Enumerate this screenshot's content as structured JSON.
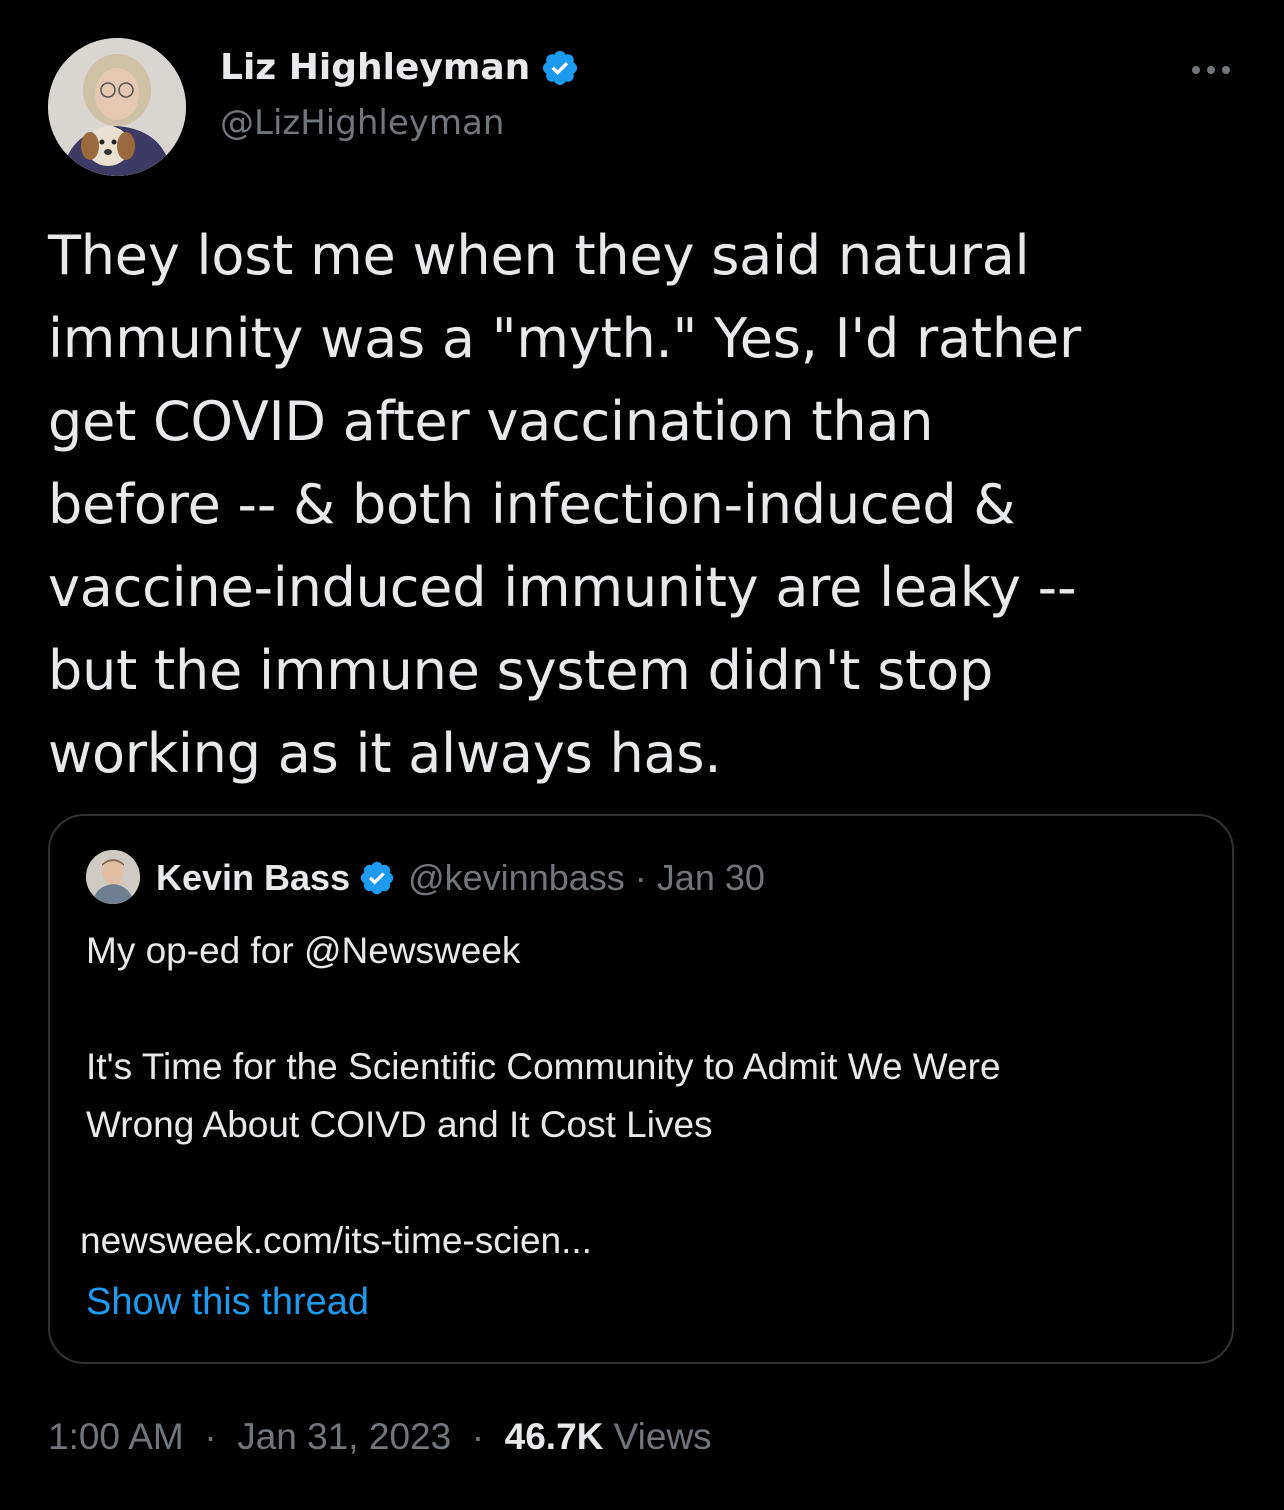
{
  "author": {
    "name": "Liz Highleyman",
    "handle": "@LizHighleyman",
    "verified": true,
    "avatar_icon": "profile-photo-with-dog"
  },
  "more_icon": "more-dots-icon",
  "tweet": {
    "text_lines": [
      "They lost me when they said natural",
      "immunity was a \"myth.\" Yes, I'd rather",
      "get COVID after vaccination than",
      "before -- & both infection-induced &",
      "vaccine-induced immunity are leaky --",
      "but the immune system didn't stop",
      "working as it always has."
    ]
  },
  "quoted_tweet": {
    "name": "Kevin Bass",
    "handle": "@kevinnbass",
    "separator": "·",
    "date": "Jan 30",
    "verified": true,
    "text_lines": [
      "My op-ed for @Newsweek",
      "",
      "It's Time for the Scientific Community to Admit We Were",
      "Wrong About COIVD and It Cost Lives",
      "",
      "newsweek.com/its-time-scien..."
    ],
    "show_thread": "Show this thread"
  },
  "footer": {
    "time": "1:00 AM",
    "separator": "·",
    "date": "Jan 31, 2023",
    "views_count": "46.7K",
    "views_label": "Views"
  },
  "colors": {
    "background": "#000000",
    "text": "#e7e9ea",
    "muted": "#71767b",
    "link": "#1d9bf0",
    "border": "#2f3336"
  }
}
